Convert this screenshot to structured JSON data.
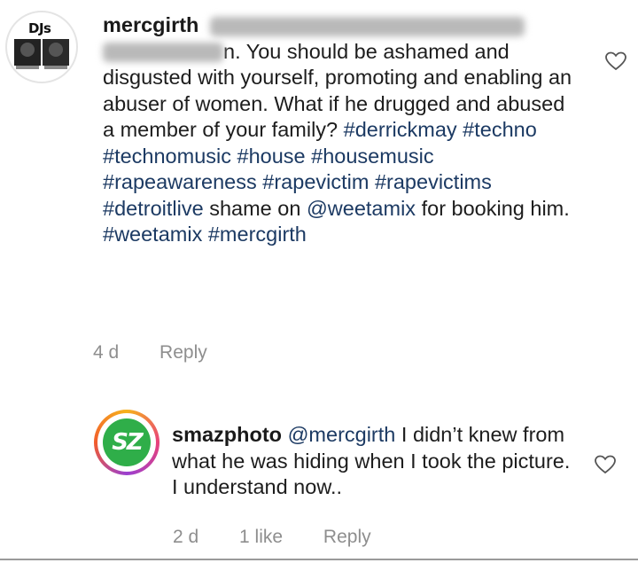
{
  "comments": [
    {
      "username": "mercgirth",
      "text_after_blur": "n. You should be ashamed and disgusted with yourself, promoting and enabling an abuser of women. What if he drugged and abused a member of your family?",
      "hashtags_line1": "#derrickmay #techno #technomusic",
      "hashtags_line2": "#house #housemusic #rapeawareness",
      "hashtags_line3a": "#rapevictim #rapevictims #detroitlive",
      "plain_shame": "shame",
      "plain_on": "on",
      "mention": "@weetamix",
      "plain_for": "for booking him.",
      "hashtag_weetamix": "#weetamix",
      "hashtag_last": "#mercgirth",
      "time": "4 d",
      "reply_label": "Reply"
    },
    {
      "username": "smazphoto",
      "mention": "@mercgirth",
      "text": "I didn’t knew from what he was hiding when I took the picture. I understand now..",
      "time": "2 d",
      "likes": "1 like",
      "reply_label": "Reply"
    }
  ],
  "avatar1_label": "DJs",
  "avatar2_label": "SZ",
  "icons": {
    "like": "heart-outline-icon"
  }
}
